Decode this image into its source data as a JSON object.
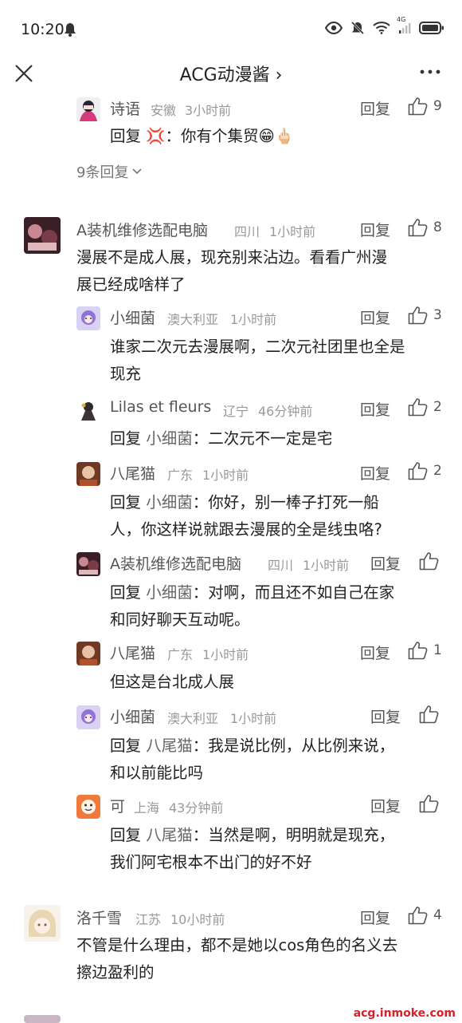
{
  "status": {
    "time": "10:20",
    "network": "4G"
  },
  "nav": {
    "title": "ACG动漫酱 ›"
  },
  "labels": {
    "reply": "回复",
    "reply_prefix": "回复",
    "colon": "："
  },
  "top_reply": {
    "name": "诗语",
    "location": "安徽",
    "time": "3小时前",
    "likes": "9",
    "target": "💢",
    "text": "你有个集贸😁🖕🏻"
  },
  "more_replies": {
    "label": "9条回复"
  },
  "comment1": {
    "name": "A装机维修选配电脑",
    "location": "四川",
    "time": "1小时前",
    "likes": "8",
    "line1": "漫展不是成人展，现充别来沾边。看看广州漫",
    "line2": "展已经成啥样了",
    "replies": [
      {
        "name": "小细菌",
        "location": "澳大利亚",
        "time": "1小时前",
        "likes": "3",
        "line1": "谁家二次元去漫展啊，二次元社团里也全是",
        "line2": "现充"
      },
      {
        "name": "Lilas et fleurs",
        "location": "辽宁",
        "time": "46分钟前",
        "likes": "2",
        "target": "小细菌",
        "line1": "二次元不一定是宅"
      },
      {
        "name": "八尾猫",
        "location": "广东",
        "time": "1小时前",
        "likes": "2",
        "target": "小细菌",
        "line1": "你好，别一棒子打死一船",
        "line2": "人，你这样说就跟去漫展的全是线虫咯?"
      },
      {
        "name": "A装机维修选配电脑",
        "location": "四川",
        "time": "1小时前",
        "likes": "",
        "target": "小细菌",
        "line1": "对啊，而且还不如自己在家",
        "line2": "和同好聊天互动呢。"
      },
      {
        "name": "八尾猫",
        "location": "广东",
        "time": "1小时前",
        "likes": "1",
        "line1": "但这是台北成人展"
      },
      {
        "name": "小细菌",
        "location": "澳大利亚",
        "time": "1小时前",
        "likes": "",
        "target": "八尾猫",
        "line1": "我是说比例，从比例来说，",
        "line2": "和以前能比吗"
      },
      {
        "name": "可",
        "location": "上海",
        "time": "43分钟前",
        "likes": "",
        "target": "八尾猫",
        "line1": "当然是啊，明明就是现充，",
        "line2": "我们阿宅根本不出门的好不好"
      }
    ]
  },
  "comment2": {
    "name": "洛千雪",
    "location": "江苏",
    "time": "10小时前",
    "likes": "4",
    "line1": "不管是什么理由，都不是她以cos角色的名义去",
    "line2": "擦边盈利的"
  },
  "watermark": "acg.inmoke.com",
  "colors": {
    "text": "#222222",
    "name": "#555555",
    "meta": "#999999",
    "watermark": "#d8202a"
  }
}
